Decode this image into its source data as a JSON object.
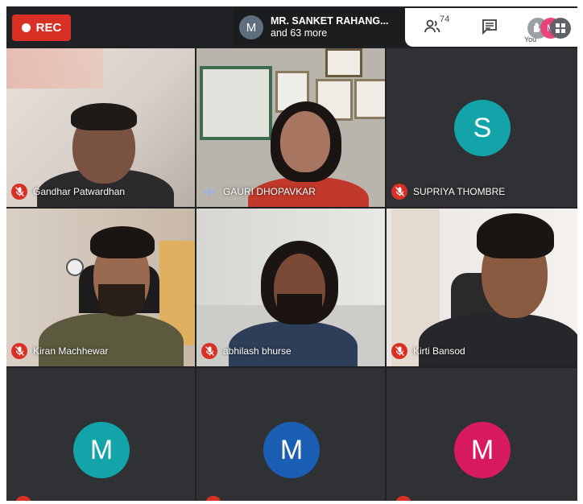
{
  "recording": {
    "label": "REC"
  },
  "presenter": {
    "initial": "M",
    "name": "MR. SANKET RAHANG...",
    "subtitle": "and 63 more"
  },
  "toolbar": {
    "participant_count": "74",
    "self_label": "You",
    "self_initial": "M"
  },
  "colors": {
    "rec_red": "#d93025",
    "grid_bg": "#202124",
    "avatar_s": "#12a4a9",
    "avatar_m1": "#12a4a9",
    "avatar_m2": "#1a5fb4",
    "avatar_m3": "#d81b60"
  },
  "participants": [
    {
      "name": "Gandhar Patwardhan",
      "mic": "off"
    },
    {
      "name": "GAURI DHOPAVKAR",
      "mic": "speaking"
    },
    {
      "name": "SUPRIYA THOMBRE",
      "mic": "off",
      "initial": "S"
    },
    {
      "name": "Kiran Machhewar",
      "mic": "off"
    },
    {
      "name": "abhilash bhurse",
      "mic": "off"
    },
    {
      "name": "Kirti Bansod",
      "mic": "off"
    },
    {
      "initial": "M"
    },
    {
      "initial": "M"
    },
    {
      "initial": "M"
    }
  ]
}
